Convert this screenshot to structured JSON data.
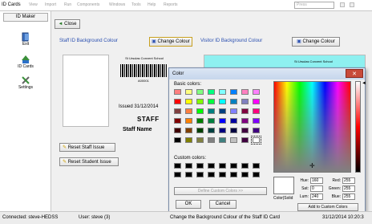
{
  "window": {
    "title": "ID Cards",
    "menus": [
      "View",
      "Import",
      "Run",
      "Components",
      "Windows",
      "Tools",
      "Help",
      "Reports"
    ],
    "combo_value": "Press"
  },
  "sidebar": {
    "header": "ID Maker",
    "items": [
      {
        "label": "Exit",
        "icon": "exit-icon"
      },
      {
        "label": "ID Cards",
        "icon": "id-cards-icon"
      },
      {
        "label": "Settings",
        "icon": "settings-icon"
      }
    ]
  },
  "toolbar": {
    "close_label": "Close"
  },
  "staff": {
    "bg_label": "Staff ID Background Colour",
    "change_label": "Change Colour",
    "school_name": "St Ursulas Convent School",
    "barcode_number": "A00001",
    "issued_text": "Issued 31/12/2014",
    "role": "STAFF",
    "name": "Staff Name"
  },
  "visitor": {
    "bg_label": "Visitor ID Background Colour",
    "change_label": "Change Colour",
    "school_name": "St Ursulas Convent School"
  },
  "actions": {
    "reset_staff": "Reset Staff Issue",
    "reset_student": "Reset Student Issue"
  },
  "colors": {
    "visitor_card_bg": "#8ef0f0",
    "accent_blue": "#2a4fb0",
    "close_red": "#c84a3a"
  },
  "color_dialog": {
    "title": "Color",
    "basic_colors_label": "Basic colors:",
    "custom_colors_label": "Custom colors:",
    "define_custom_label": "Define Custom Colors >>",
    "ok_label": "OK",
    "cancel_label": "Cancel",
    "add_custom_label": "Add to Custom Colors",
    "color_solid_label": "Color|Solid",
    "hue_label": "Hue:",
    "hue_value": "160",
    "sat_label": "Sat:",
    "sat_value": "0",
    "lum_label": "Lum:",
    "lum_value": "240",
    "red_label": "Red:",
    "red_value": "255",
    "green_label": "Green:",
    "green_value": "255",
    "blue_label": "Blue:",
    "blue_value": "255",
    "basic_colors": [
      "#ff8080",
      "#ffff80",
      "#80ff80",
      "#00ff80",
      "#80ffff",
      "#0080ff",
      "#ff80c0",
      "#ff80ff",
      "#ff0000",
      "#ffff00",
      "#80ff00",
      "#00ff40",
      "#00ffff",
      "#0080c0",
      "#8080c0",
      "#ff00ff",
      "#804040",
      "#ff8040",
      "#00ff00",
      "#008080",
      "#004080",
      "#8080ff",
      "#800040",
      "#ff0080",
      "#800000",
      "#ff8000",
      "#008000",
      "#008040",
      "#0000ff",
      "#0000a0",
      "#800080",
      "#8000ff",
      "#400000",
      "#804000",
      "#004000",
      "#004040",
      "#000080",
      "#000040",
      "#400040",
      "#400080",
      "#000000",
      "#808000",
      "#808040",
      "#808080",
      "#408080",
      "#c0c0c0",
      "#400040",
      "#ffffff"
    ],
    "custom_colors": [
      "#000000",
      "#000000",
      "#000000",
      "#000000",
      "#000000",
      "#000000",
      "#000000",
      "#000000",
      "#000000",
      "#000000",
      "#000000",
      "#000000",
      "#000000",
      "#000000",
      "#000000",
      "#000000"
    ]
  },
  "status": {
    "connected": "Connected: steve-HEDSS",
    "user": "User: steve (3)",
    "message": "Change the Background Colour of the Staff ID Card",
    "datetime": "31/12/2014 10:20:3"
  }
}
